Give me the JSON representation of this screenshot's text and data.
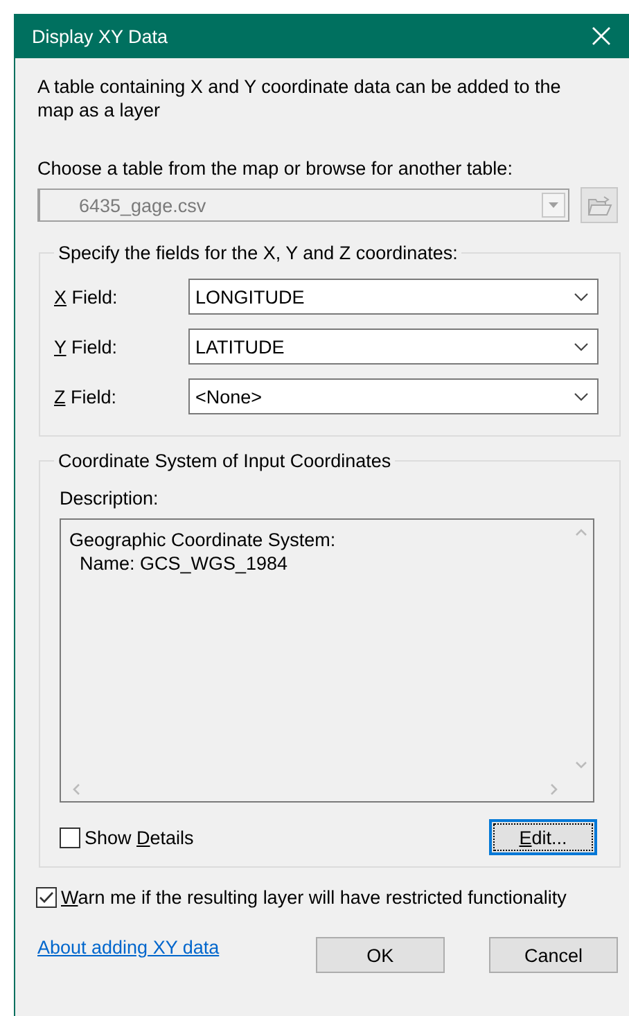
{
  "window": {
    "title": "Display XY Data"
  },
  "intro": "A table containing X and Y coordinate data can be added to the map as a layer",
  "table_prompt": "Choose a table from the map or browse for another table:",
  "table_combo": {
    "value": "6435_gage.csv",
    "disabled": true
  },
  "fields_group": {
    "title": "Specify the fields for the X, Y and Z coordinates:",
    "fields": [
      {
        "label": {
          "key": "X",
          "after": " Field:"
        },
        "value": "LONGITUDE"
      },
      {
        "label": {
          "key": "Y",
          "after": " Field:"
        },
        "value": "LATITUDE"
      },
      {
        "label": {
          "key": "Z",
          "after": " Field:"
        },
        "value": "<None>"
      }
    ]
  },
  "coordinate_group": {
    "title": "Coordinate System of Input Coordinates",
    "description_label": "Description:",
    "description_lines": [
      "Geographic Coordinate System:",
      "  Name: GCS_WGS_1984"
    ],
    "show_details": {
      "label": {
        "before": "Show ",
        "key": "D",
        "after": "etails"
      },
      "checked": false
    },
    "edit_button": {
      "label": {
        "key": "E",
        "after": "dit..."
      },
      "focused": true
    }
  },
  "warn": {
    "label": {
      "key": "W",
      "after": "arn me if the resulting layer will have restricted functionality"
    },
    "checked": true
  },
  "help_link": "About adding XY data",
  "buttons": [
    "OK",
    "Cancel"
  ]
}
